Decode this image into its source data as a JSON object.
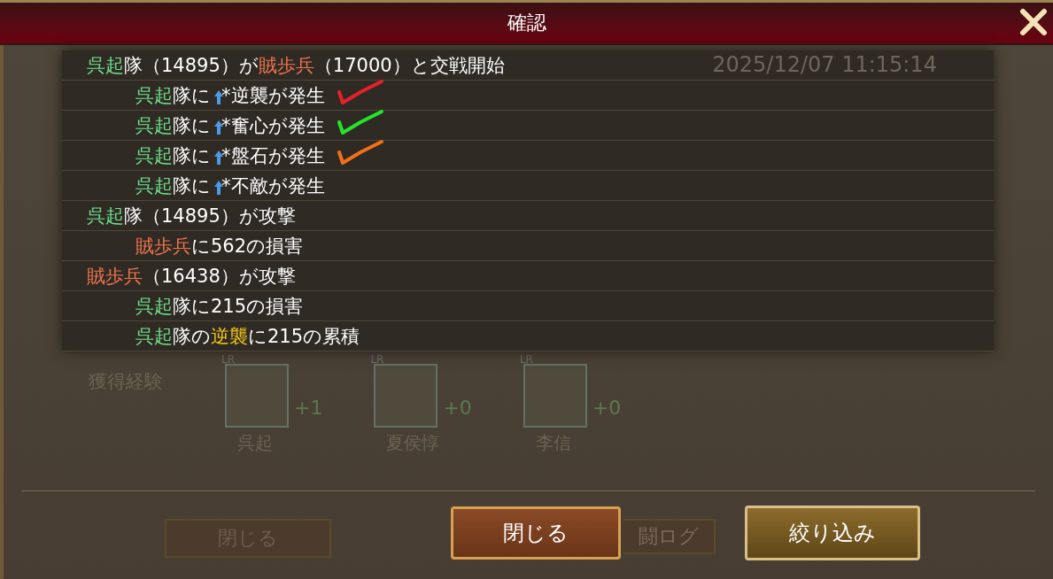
{
  "dialog": {
    "title": "確認"
  },
  "log": [
    {
      "segments": [
        {
          "kind": "ally",
          "text": "呉起"
        },
        {
          "kind": "text",
          "text": "隊（14895）が"
        },
        {
          "kind": "enemy",
          "text": "賊歩兵"
        },
        {
          "kind": "text",
          "text": "（17000）と交戦開始"
        }
      ],
      "children": [
        {
          "segments": [
            {
              "kind": "ally",
              "text": "呉起"
            },
            {
              "kind": "text",
              "text": "隊に"
            },
            {
              "kind": "buff"
            },
            {
              "kind": "text",
              "text": "*逆襲が発生"
            }
          ],
          "tick": {
            "color": "#e8202a"
          }
        },
        {
          "segments": [
            {
              "kind": "ally",
              "text": "呉起"
            },
            {
              "kind": "text",
              "text": "隊に"
            },
            {
              "kind": "buff"
            },
            {
              "kind": "text",
              "text": "*奮心が発生"
            }
          ],
          "tick": {
            "color": "#22e62a"
          }
        },
        {
          "segments": [
            {
              "kind": "ally",
              "text": "呉起"
            },
            {
              "kind": "text",
              "text": "隊に"
            },
            {
              "kind": "buff"
            },
            {
              "kind": "text",
              "text": "*盤石が発生"
            }
          ],
          "tick": {
            "color": "#f07018"
          }
        },
        {
          "segments": [
            {
              "kind": "ally",
              "text": "呉起"
            },
            {
              "kind": "text",
              "text": "隊に"
            },
            {
              "kind": "buff"
            },
            {
              "kind": "text",
              "text": "*不敵が発生"
            }
          ]
        }
      ]
    },
    {
      "segments": [
        {
          "kind": "ally",
          "text": "呉起"
        },
        {
          "kind": "text",
          "text": "隊（14895）が攻撃"
        }
      ],
      "children": [
        {
          "segments": [
            {
              "kind": "enemy",
              "text": "賊歩兵"
            },
            {
              "kind": "text",
              "text": "に562の損害"
            }
          ]
        }
      ]
    },
    {
      "segments": [
        {
          "kind": "enemy",
          "text": "賊歩兵"
        },
        {
          "kind": "text",
          "text": "（16438）が攻撃"
        }
      ],
      "children": [
        {
          "segments": [
            {
              "kind": "ally",
              "text": "呉起"
            },
            {
              "kind": "text",
              "text": "隊に215の損害"
            }
          ]
        },
        {
          "segments": [
            {
              "kind": "ally",
              "text": "呉起"
            },
            {
              "kind": "text",
              "text": "隊の"
            },
            {
              "kind": "skill",
              "text": "逆襲"
            },
            {
              "kind": "text",
              "text": "に215の累積"
            }
          ]
        }
      ]
    }
  ],
  "background": {
    "timestamp": "2025/12/07  11:15:14",
    "exp_label": "獲得経験",
    "generals": [
      {
        "rarity": "LR",
        "name": "呉起",
        "exp": "+1"
      },
      {
        "rarity": "LR",
        "name": "夏侯惇",
        "exp": "+0"
      },
      {
        "rarity": "LR",
        "name": "李信",
        "exp": "+0"
      }
    ],
    "buttons": [
      {
        "label": "閉じる"
      },
      {
        "label": "闘ログ"
      }
    ]
  },
  "buttons": [
    {
      "label": "閉じる",
      "kind": "close"
    },
    {
      "label": "絞り込み",
      "kind": "filter"
    }
  ]
}
